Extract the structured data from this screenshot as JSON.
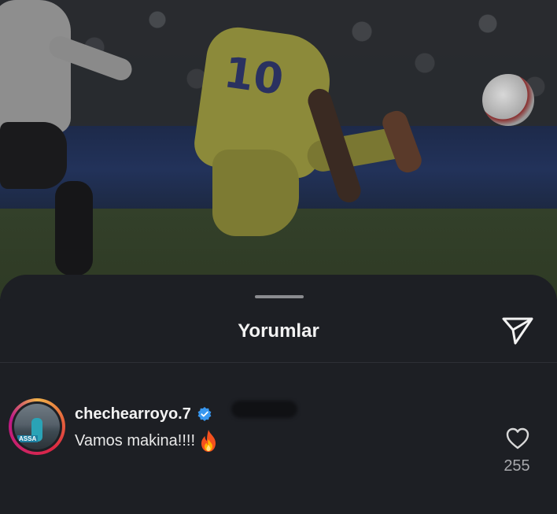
{
  "photo": {
    "shirt_number": "10"
  },
  "sheet": {
    "title": "Yorumlar"
  },
  "comment": {
    "username": "chechearroyo.7",
    "verified": true,
    "avatar_text": "ASSA",
    "text": "Vamos makina!!!!",
    "emoji": "fire-emoji",
    "like_count": "255"
  },
  "icons": {
    "send": "send-icon",
    "like": "heart-icon",
    "verified": "verified-badge-icon"
  },
  "colors": {
    "sheet_bg": "#1d1f24",
    "verified_blue": "#3897f0",
    "text_primary": "#f2f2f2",
    "text_secondary": "#a8a9ad"
  }
}
